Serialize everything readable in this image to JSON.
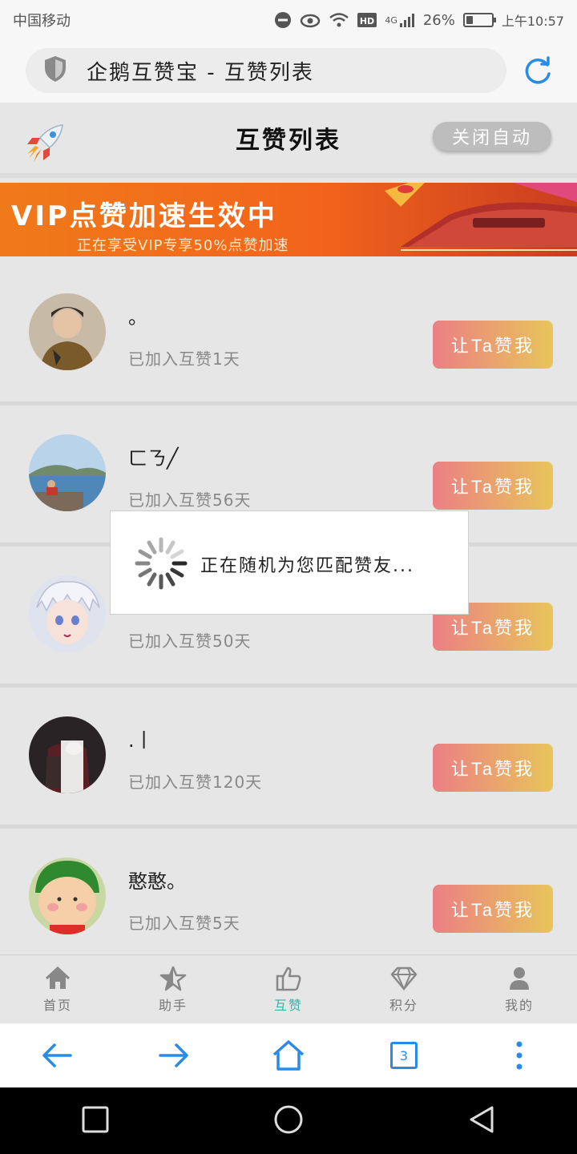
{
  "status_bar": {
    "carrier": "中国移动",
    "network": "4G",
    "battery_percent": "26%",
    "battery_level": 0.26,
    "time": "上午10:57"
  },
  "browser": {
    "address_title": "企鹅互赞宝 - 互赞列表",
    "tab_count": "3"
  },
  "header": {
    "title": "互赞列表",
    "close_auto_label": "关闭自动"
  },
  "banner": {
    "headline": "VIP点赞加速生效中",
    "subline": "正在享受VIP专享50%点赞加速"
  },
  "list": {
    "items": [
      {
        "nickname": "。",
        "joined": "已加入互赞1天",
        "button": "让Ta赞我"
      },
      {
        "nickname": "ㄈㄋ╱",
        "joined": "已加入互赞56天",
        "button": "让Ta赞我"
      },
      {
        "nickname": "",
        "joined": "已加入互赞50天",
        "button": "让Ta赞我"
      },
      {
        "nickname": ".丨",
        "joined": "已加入互赞120天",
        "button": "让Ta赞我"
      },
      {
        "nickname": "憨憨。",
        "joined": "已加入互赞5天",
        "button": "让Ta赞我"
      }
    ]
  },
  "dialog": {
    "message": "正在随机为您匹配赞友..."
  },
  "app_nav": {
    "items": [
      {
        "label": "首页",
        "icon": "home-icon"
      },
      {
        "label": "助手",
        "icon": "star-icon"
      },
      {
        "label": "互赞",
        "icon": "thumbs-up-icon"
      },
      {
        "label": "积分",
        "icon": "diamond-icon"
      },
      {
        "label": "我的",
        "icon": "user-icon"
      }
    ],
    "active_index": 2
  },
  "colors": {
    "accent": "#3bb2a6",
    "button_gradient_start": "#ec7f84",
    "button_gradient_end": "#e8c55a",
    "browser_blue": "#2a8be6"
  }
}
